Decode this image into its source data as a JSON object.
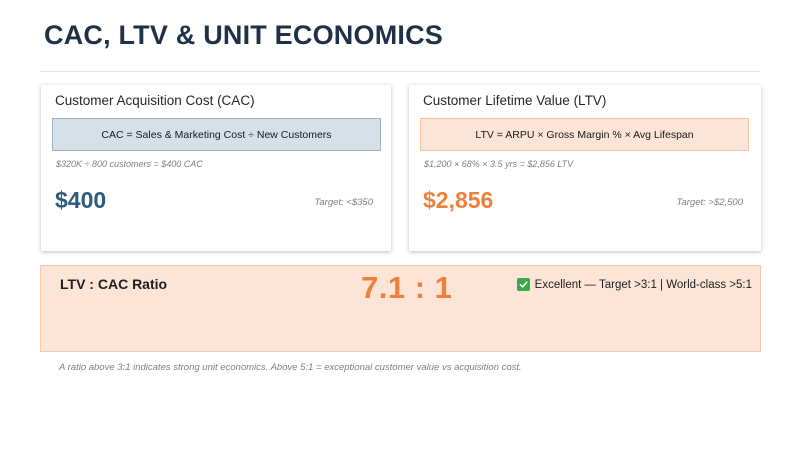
{
  "page": {
    "title": "CAC, LTV & UNIT ECONOMICS"
  },
  "cac_card": {
    "title": "Customer Acquisition Cost (CAC)",
    "formula": "CAC = Sales & Marketing Cost ÷ New Customers",
    "calculation": "$320K ÷ 800 customers = $400 CAC",
    "value": "$400",
    "target": "Target: <$350",
    "accent_color": "#2e5a7c"
  },
  "ltv_card": {
    "title": "Customer Lifetime Value (LTV)",
    "formula": "LTV = ARPU × Gross Margin % × Avg Lifespan",
    "calculation": "$1,200 × 68% × 3.5 yrs = $2,856 LTV",
    "value": "$2,856",
    "target": "Target: >$2,500",
    "accent_color": "#ef7f3c"
  },
  "ratio": {
    "title": "LTV : CAC Ratio",
    "value": "7.1 : 1",
    "status_icon": "check-mark-icon",
    "status_text": "Excellent — Target >3:1 | World-class >5:1",
    "background_color": "#fce4d6"
  },
  "footnote": "A ratio above 3:1 indicates strong unit economics. Above 5:1 = exceptional customer value vs acquisition cost."
}
